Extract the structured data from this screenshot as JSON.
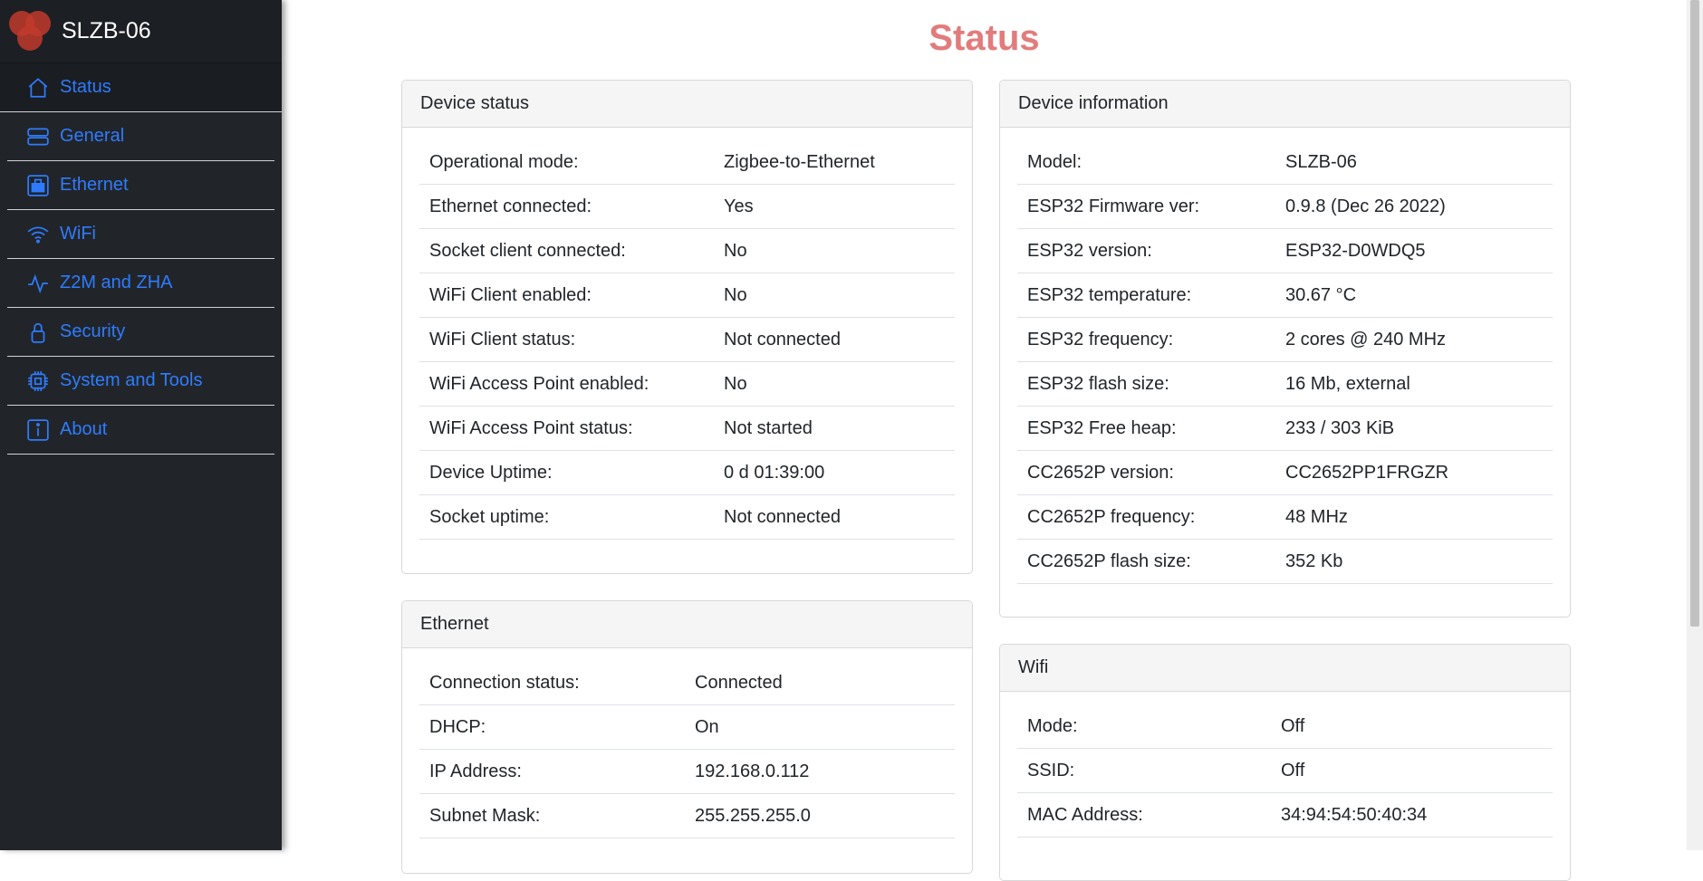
{
  "app": {
    "title": "SLZB-06"
  },
  "colors": {
    "link": "#2f7bff",
    "title": "#e27c7c",
    "sidebar_bg": "#212529"
  },
  "sidebar": {
    "items": [
      {
        "label": "Status",
        "icon": "home-icon",
        "active": true
      },
      {
        "label": "General",
        "icon": "server-icon"
      },
      {
        "label": "Ethernet",
        "icon": "ethernet-icon"
      },
      {
        "label": "WiFi",
        "icon": "wifi-icon"
      },
      {
        "label": "Z2M and ZHA",
        "icon": "activity-icon"
      },
      {
        "label": "Security",
        "icon": "lock-icon"
      },
      {
        "label": "System and Tools",
        "icon": "cpu-icon"
      },
      {
        "label": "About",
        "icon": "info-icon"
      }
    ]
  },
  "page": {
    "title": "Status"
  },
  "cards": {
    "device_status": {
      "title": "Device status",
      "rows": [
        {
          "label": "Operational mode:",
          "value": "Zigbee-to-Ethernet"
        },
        {
          "label": "Ethernet connected:",
          "value": "Yes"
        },
        {
          "label": "Socket client connected:",
          "value": "No"
        },
        {
          "label": "WiFi Client enabled:",
          "value": "No"
        },
        {
          "label": "WiFi Client status:",
          "value": "Not connected"
        },
        {
          "label": "WiFi Access Point enabled:",
          "value": "No"
        },
        {
          "label": "WiFi Access Point status:",
          "value": "Not started"
        },
        {
          "label": "Device Uptime:",
          "value": "0 d 01:39:00"
        },
        {
          "label": "Socket uptime:",
          "value": "Not connected"
        }
      ]
    },
    "device_information": {
      "title": "Device information",
      "rows": [
        {
          "label": "Model:",
          "value": "SLZB-06"
        },
        {
          "label": "ESP32 Firmware ver:",
          "value": "0.9.8 (Dec 26 2022)"
        },
        {
          "label": "ESP32 version:",
          "value": "ESP32-D0WDQ5"
        },
        {
          "label": "ESP32 temperature:",
          "value": "30.67 °C"
        },
        {
          "label": "ESP32 frequency:",
          "value": "2 cores @ 240 MHz"
        },
        {
          "label": "ESP32 flash size:",
          "value": "16 Mb, external"
        },
        {
          "label": "ESP32 Free heap:",
          "value": "233 / 303 KiB"
        },
        {
          "label": "CC2652P version:",
          "value": "CC2652PP1FRGZR"
        },
        {
          "label": "CC2652P frequency:",
          "value": "48 MHz"
        },
        {
          "label": "CC2652P flash size:",
          "value": "352 Kb"
        }
      ]
    },
    "ethernet": {
      "title": "Ethernet",
      "rows": [
        {
          "label": "Connection status:",
          "value": "Connected"
        },
        {
          "label": "DHCP:",
          "value": "On"
        },
        {
          "label": "IP Address:",
          "value": "192.168.0.112"
        },
        {
          "label": "Subnet Mask:",
          "value": "255.255.255.0"
        }
      ]
    },
    "wifi": {
      "title": "Wifi",
      "rows": [
        {
          "label": "Mode:",
          "value": "Off"
        },
        {
          "label": "SSID:",
          "value": "Off"
        },
        {
          "label": "MAC Address:",
          "value": "34:94:54:50:40:34"
        }
      ]
    }
  }
}
